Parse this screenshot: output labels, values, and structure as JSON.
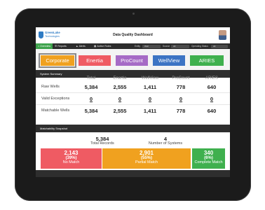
{
  "header": {
    "logo_line1": "GreenLake",
    "logo_line2": "Technologies",
    "title": "Data Quality Dashboard"
  },
  "nav": {
    "items": [
      {
        "label": "Overview",
        "icon": "home-icon"
      },
      {
        "label": "Reports",
        "icon": "list-icon"
      },
      {
        "label": "Alerts",
        "icon": "bell-icon"
      },
      {
        "label": "Active Rules",
        "icon": "grid-icon"
      }
    ],
    "filters": [
      {
        "label": "Entity",
        "value": "Well"
      },
      {
        "label": "Source",
        "value": "All"
      },
      {
        "label": "Operating Status",
        "value": "All"
      }
    ]
  },
  "tabs": [
    {
      "label": "Corporate",
      "color": "#f0a11f"
    },
    {
      "label": "Enertia",
      "color": "#ef5b63"
    },
    {
      "label": "ProCount",
      "color": "#a66bc6"
    },
    {
      "label": "WellView",
      "color": "#3c74c4"
    },
    {
      "label": "ARIES",
      "color": "#3fb04e"
    }
  ],
  "summary": {
    "title": "System Summary",
    "columns": [
      "Total",
      "Enertia",
      "WellView",
      "ProCount",
      "ARIES"
    ],
    "rows": [
      {
        "label": "Raw Wells",
        "values": [
          "5,384",
          "2,555",
          "1,411",
          "778",
          "640"
        ]
      },
      {
        "label": "Valid Exceptions",
        "values": [
          "0",
          "0",
          "0",
          "0",
          "0"
        ]
      },
      {
        "label": "Matchable Wells",
        "values": [
          "5,384",
          "2,555",
          "1,411",
          "778",
          "640"
        ]
      }
    ]
  },
  "matchability": {
    "title": "Matchability Snapshot",
    "total_records": "5,384",
    "total_records_label": "Total Records",
    "systems": "4",
    "systems_label": "Number of Systems",
    "boxes": [
      {
        "value": "2,143",
        "pct": "(39%)",
        "label": "No Match",
        "color": "#ef5b63"
      },
      {
        "value": "2,901",
        "pct": "(55%)",
        "label": "Partial Match",
        "color": "#f0a11f"
      },
      {
        "value": "340",
        "pct": "(6%)",
        "label": "Complete Match",
        "color": "#3fb04e"
      }
    ]
  }
}
